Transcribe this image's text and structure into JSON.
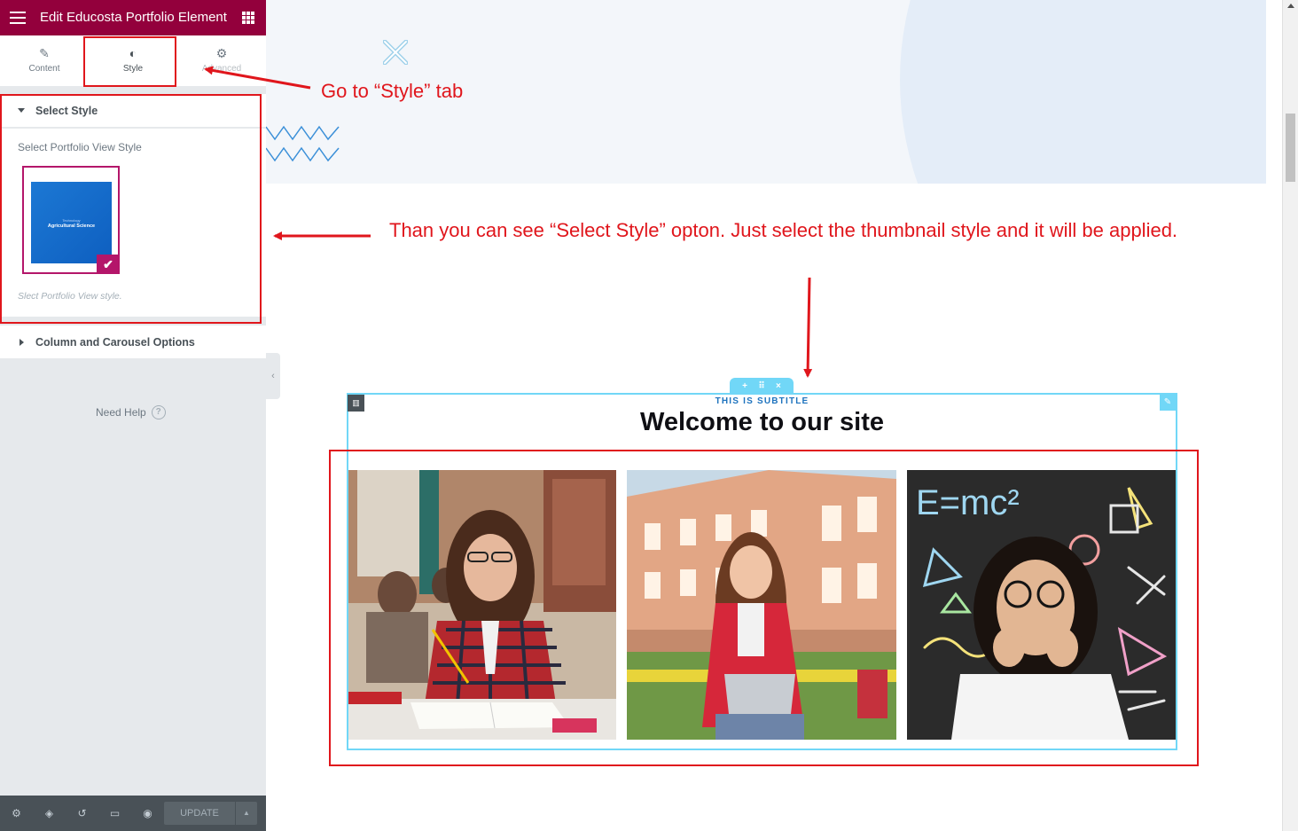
{
  "panel": {
    "title": "Edit Educosta Portfolio Element",
    "tabs": [
      {
        "label": "Content",
        "icon": "pencil-icon"
      },
      {
        "label": "Style",
        "icon": "half-circle-icon"
      },
      {
        "label": "Advanced",
        "icon": "gear-icon"
      }
    ],
    "active_tab": "Style",
    "sections": {
      "select_style": {
        "title": "Select Style",
        "control_label": "Select Portfolio View Style",
        "thumbnail": {
          "line1": "Technology",
          "line2": "Agricultural Science",
          "selected": true
        },
        "description": "Slect Portfolio View style."
      },
      "column_carousel": {
        "title": "Column and Carousel Options"
      }
    },
    "need_help": "Need Help",
    "footer": {
      "icons": [
        "settings-icon",
        "layers-icon",
        "history-icon",
        "responsive-icon",
        "preview-eye-icon"
      ],
      "update_label": "UPDATE"
    }
  },
  "preview": {
    "subtitle": "THIS IS SUBTITLE",
    "heading": "Welcome to our site",
    "portfolio_items": [
      {
        "alt": "student-studying-photo"
      },
      {
        "alt": "student-with-laptop-photo"
      },
      {
        "alt": "girl-thinking-chalkboard-photo"
      }
    ],
    "handle_icons": [
      "+",
      "⠿",
      "×"
    ]
  },
  "annotations": {
    "step1": "Go  to “Style” tab",
    "step2": "Than you  can see “Select Style” opton. Just select the thumbnail style and it will be applied."
  },
  "colors": {
    "brand": "#93003c",
    "annotation": "#e0161c",
    "selection": "#71d7f7",
    "subtitle": "#1e73be"
  }
}
